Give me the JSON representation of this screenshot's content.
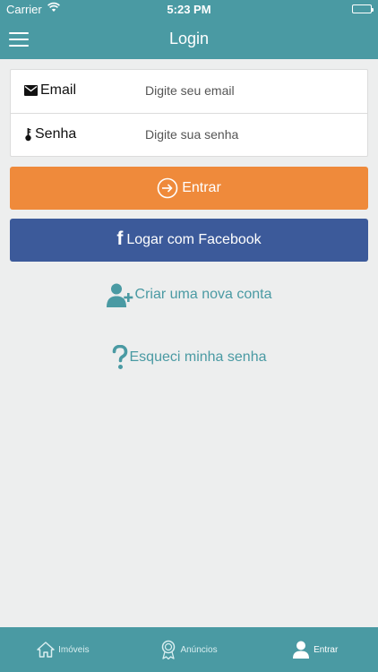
{
  "status_bar": {
    "carrier": "Carrier",
    "time": "5:23 PM"
  },
  "navbar": {
    "title": "Login"
  },
  "form": {
    "email_label": "Email",
    "email_placeholder": "Digite seu email",
    "password_label": "Senha",
    "password_placeholder": "Digite sua senha"
  },
  "buttons": {
    "login_label": "Entrar",
    "facebook_label": "Logar com Facebook"
  },
  "links": {
    "create_account": "Criar uma nova conta",
    "forgot_password": "Esqueci minha senha"
  },
  "tab_bar": {
    "items": [
      {
        "label": "Imóveis",
        "icon": "home-icon"
      },
      {
        "label": "Anúncios",
        "icon": "badge-icon"
      },
      {
        "label": "Entrar",
        "icon": "user-icon",
        "active": true
      }
    ]
  },
  "colors": {
    "brand": "#4a9aa3",
    "login_button": "#ef8a3b",
    "facebook_button": "#3c5a9a",
    "background": "#edeeee"
  }
}
